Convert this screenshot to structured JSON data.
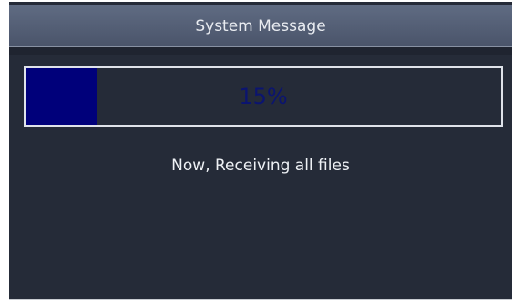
{
  "dialog": {
    "title": "System Message",
    "progress": {
      "percent": 15,
      "label": "15%"
    },
    "status": "Now, Receiving all files"
  },
  "colors": {
    "background": "#252b38",
    "title_bar": "#556078",
    "progress_fill": "#00007a",
    "progress_text": "#0b1470",
    "text": "#eef1f5"
  }
}
